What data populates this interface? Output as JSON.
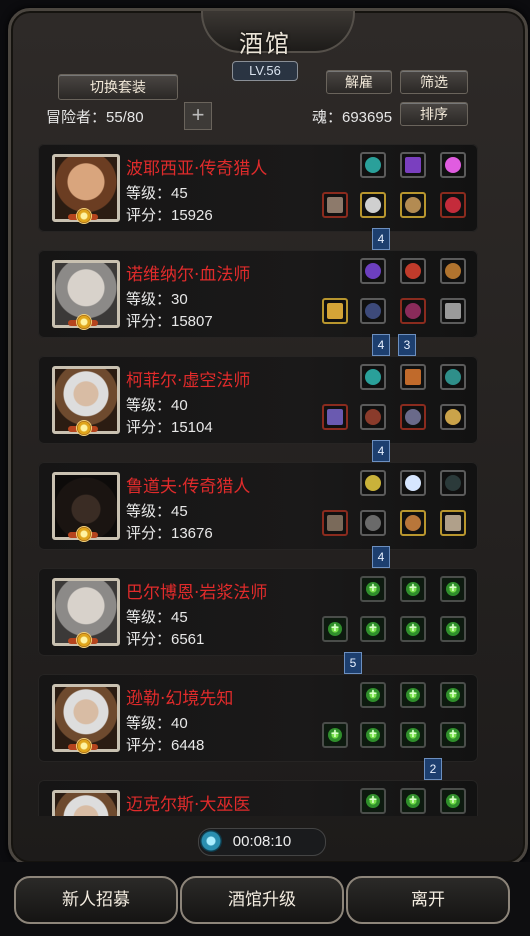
{
  "header": {
    "title": "酒馆",
    "level": "LV.56",
    "switch_set": "切换套装",
    "dismiss": "解雇",
    "filter": "筛选",
    "sort": "排序"
  },
  "stats": {
    "adventurers_label": "冒险者：55/80",
    "souls_label": "魂：693695",
    "add": "+"
  },
  "heroes": [
    {
      "name": "波耶西亚·传奇猎人",
      "level": "等级：45",
      "score": "评分：15926",
      "portrait": "hero-dark-hair",
      "link": [
        "4"
      ],
      "equipped": true
    },
    {
      "name": "诺维纳尔·血法师",
      "level": "等级：30",
      "score": "评分：15807",
      "portrait": "hero-elf-pale",
      "link": [
        "4",
        "3"
      ],
      "equipped": true
    },
    {
      "name": "柯菲尔·虚空法师",
      "level": "等级：40",
      "score": "评分：15104",
      "portrait": "hero-elder-beard",
      "link": [
        "4"
      ],
      "equipped": true
    },
    {
      "name": "鲁道夫·传奇猎人",
      "level": "等级：45",
      "score": "评分：13676",
      "portrait": "hero-hat",
      "link": [
        "4"
      ],
      "equipped": true
    },
    {
      "name": "巴尔博恩·岩浆法师",
      "level": "等级：45",
      "score": "评分：6561",
      "portrait": "hero-elf-pale",
      "link": [
        "5"
      ],
      "equipped": false
    },
    {
      "name": "逊勒·幻境先知",
      "level": "等级：40",
      "score": "评分：6448",
      "portrait": "hero-elder-beard",
      "link": [
        "2"
      ],
      "equipped": false
    },
    {
      "name": "迈克尔斯·大巫医",
      "level": "",
      "score": "",
      "portrait": "hero-elder-beard",
      "link": [],
      "equipped": false
    }
  ],
  "timer": "00:08:10",
  "footer": {
    "recruit": "新人招募",
    "upgrade": "酒馆升级",
    "leave": "离开"
  }
}
